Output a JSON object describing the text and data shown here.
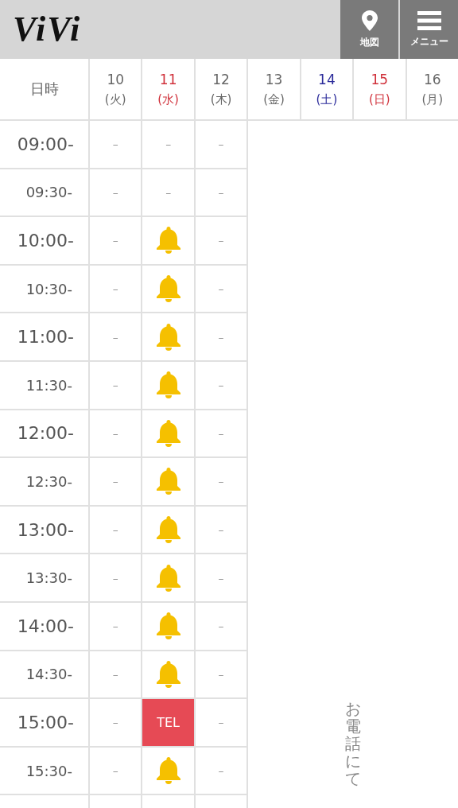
{
  "header": {
    "logo": "ViVi",
    "buttons": [
      {
        "kind": "map",
        "label": "地図"
      },
      {
        "kind": "menu",
        "label": "メニュー"
      }
    ]
  },
  "table": {
    "corner": "日時",
    "days": [
      {
        "date": "10",
        "weekday": "(火)",
        "color": "#666666"
      },
      {
        "date": "11",
        "weekday": "(水)",
        "color": "#d0303a"
      },
      {
        "date": "12",
        "weekday": "(木)",
        "color": "#666666"
      },
      {
        "date": "13",
        "weekday": "(金)",
        "color": "#666666"
      },
      {
        "date": "14",
        "weekday": "(土)",
        "color": "#2a2a9a"
      },
      {
        "date": "15",
        "weekday": "(日)",
        "color": "#d0303a"
      },
      {
        "date": "16",
        "weekday": "(月)",
        "color": "#666666"
      }
    ],
    "rows": [
      {
        "time": "09:00-",
        "cells": [
          {
            "kind": "dash",
            "text": "–"
          },
          {
            "kind": "dash",
            "text": "–"
          },
          {
            "kind": "dash",
            "text": "–"
          }
        ]
      },
      {
        "time": "09:30-",
        "cells": [
          {
            "kind": "dash",
            "text": "–"
          },
          {
            "kind": "dash",
            "text": "–"
          },
          {
            "kind": "dash",
            "text": "–"
          }
        ]
      },
      {
        "time": "10:00-",
        "cells": [
          {
            "kind": "dash",
            "text": "–"
          },
          {
            "kind": "bell"
          },
          {
            "kind": "dash",
            "text": "–"
          }
        ]
      },
      {
        "time": "10:30-",
        "cells": [
          {
            "kind": "dash",
            "text": "–"
          },
          {
            "kind": "bell"
          },
          {
            "kind": "dash",
            "text": "–"
          }
        ]
      },
      {
        "time": "11:00-",
        "cells": [
          {
            "kind": "dash",
            "text": "–"
          },
          {
            "kind": "bell"
          },
          {
            "kind": "dash",
            "text": "–"
          }
        ]
      },
      {
        "time": "11:30-",
        "cells": [
          {
            "kind": "dash",
            "text": "–"
          },
          {
            "kind": "bell"
          },
          {
            "kind": "dash",
            "text": "–"
          }
        ]
      },
      {
        "time": "12:00-",
        "cells": [
          {
            "kind": "dash",
            "text": "–"
          },
          {
            "kind": "bell"
          },
          {
            "kind": "dash",
            "text": "–"
          }
        ]
      },
      {
        "time": "12:30-",
        "cells": [
          {
            "kind": "dash",
            "text": "–"
          },
          {
            "kind": "bell"
          },
          {
            "kind": "dash",
            "text": "–"
          }
        ]
      },
      {
        "time": "13:00-",
        "cells": [
          {
            "kind": "dash",
            "text": "–"
          },
          {
            "kind": "bell"
          },
          {
            "kind": "dash",
            "text": "–"
          }
        ]
      },
      {
        "time": "13:30-",
        "cells": [
          {
            "kind": "dash",
            "text": "–"
          },
          {
            "kind": "bell"
          },
          {
            "kind": "dash",
            "text": "–"
          }
        ]
      },
      {
        "time": "14:00-",
        "cells": [
          {
            "kind": "dash",
            "text": "–"
          },
          {
            "kind": "bell"
          },
          {
            "kind": "dash",
            "text": "–"
          }
        ]
      },
      {
        "time": "14:30-",
        "cells": [
          {
            "kind": "dash",
            "text": "–"
          },
          {
            "kind": "bell"
          },
          {
            "kind": "dash",
            "text": "–"
          }
        ]
      },
      {
        "time": "15:00-",
        "cells": [
          {
            "kind": "dash",
            "text": "–"
          },
          {
            "kind": "tel",
            "text": "TEL"
          },
          {
            "kind": "dash",
            "text": "–"
          }
        ]
      },
      {
        "time": "15:30-",
        "cells": [
          {
            "kind": "dash",
            "text": "–"
          },
          {
            "kind": "bell"
          },
          {
            "kind": "dash",
            "text": "–"
          }
        ]
      }
    ],
    "note": "お電話にて"
  }
}
